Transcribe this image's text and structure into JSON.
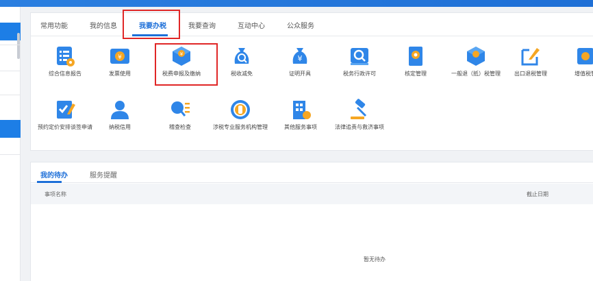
{
  "nav_tabs": [
    "常用功能",
    "我的信息",
    "我要办税",
    "我要查询",
    "互动中心",
    "公众服务"
  ],
  "active_nav_tab": "我要办税",
  "services": [
    {
      "label": "综合信息报告",
      "icon": "report-icon"
    },
    {
      "label": "发票使用",
      "icon": "invoice-icon"
    },
    {
      "label": "税费申报及缴纳",
      "icon": "tax-declare-icon"
    },
    {
      "label": "税收减免",
      "icon": "money-bag-search-icon"
    },
    {
      "label": "证明开具",
      "icon": "money-bag-yen-icon"
    },
    {
      "label": "税务行政许可",
      "icon": "permit-search-icon"
    },
    {
      "label": "核定管理",
      "icon": "document-gear-icon"
    },
    {
      "label": "一般退（抵）税管理",
      "icon": "refund-box-icon"
    },
    {
      "label": "出口退税管理",
      "icon": "edit-pen-icon"
    },
    {
      "label": "增值税管",
      "icon": "tax-gear-icon"
    },
    {
      "label": "预约定价安排谈签申请",
      "icon": "checklist-pen-icon"
    },
    {
      "label": "纳税信用",
      "icon": "user-icon"
    },
    {
      "label": "稽查检查",
      "icon": "magnifier-list-icon"
    },
    {
      "label": "涉税专业服务机构管理",
      "icon": "coin-icon"
    },
    {
      "label": "其他服务事项",
      "icon": "building-icon"
    },
    {
      "label": "法律追责与救济事项",
      "icon": "gavel-icon"
    }
  ],
  "bottom_tabs": [
    "我的待办",
    "服务提醒"
  ],
  "active_bottom_tab": "我的待办",
  "table_headers": {
    "name": "事项名称",
    "deadline": "截止日期"
  },
  "empty_text": "暂无待办",
  "colors": {
    "primary": "#1d6fd8",
    "highlight": "#e02626",
    "icon_blue": "#2f86e8",
    "icon_orange": "#f5a623"
  }
}
